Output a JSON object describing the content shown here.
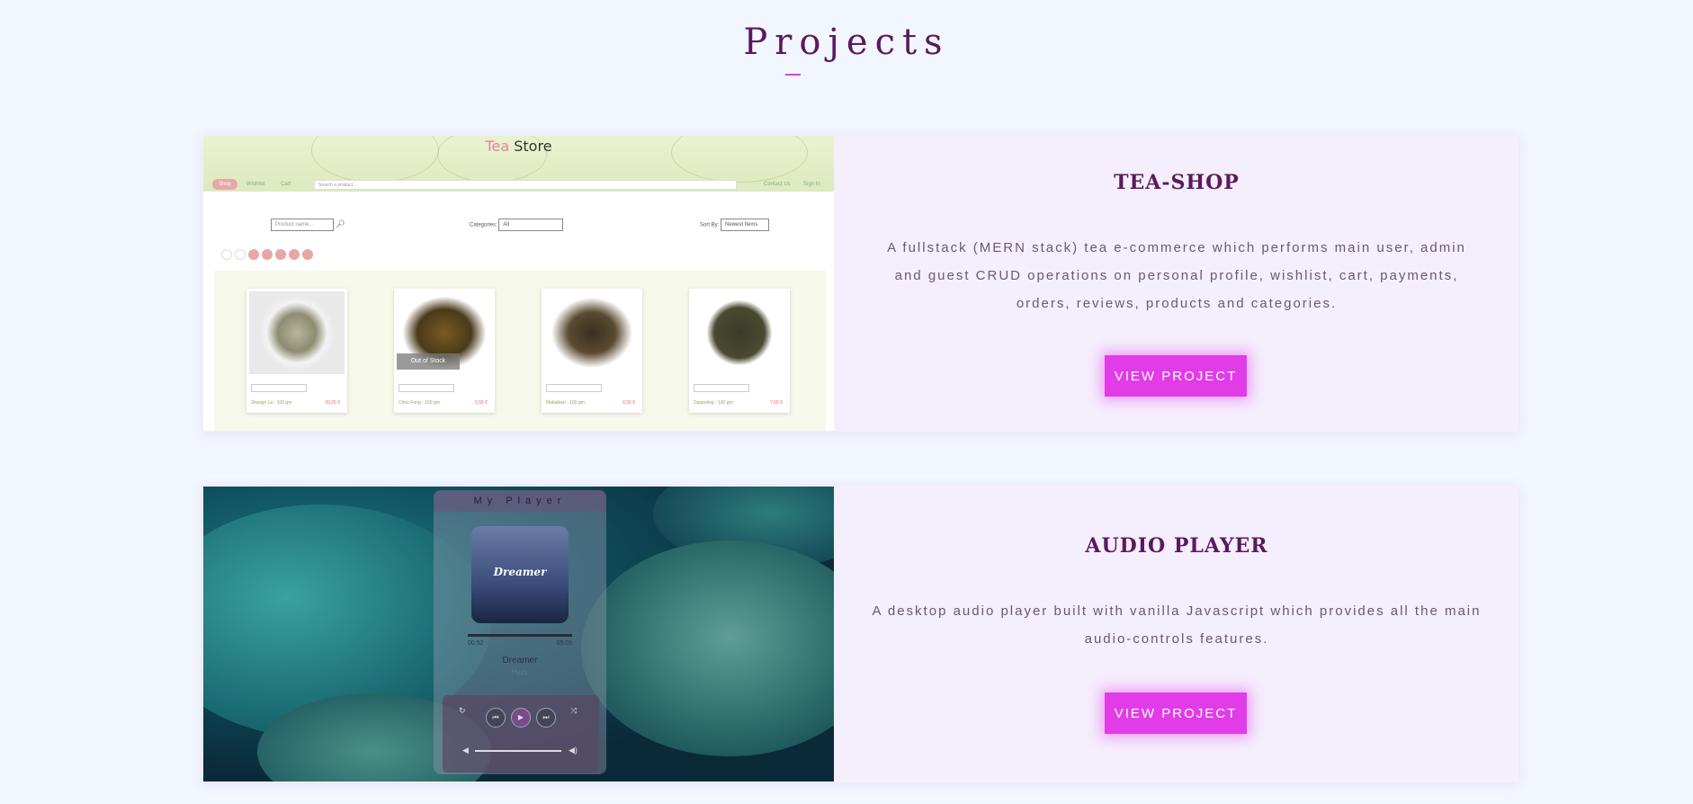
{
  "section": {
    "title": "Projects"
  },
  "projects": [
    {
      "title": "TEA-SHOP",
      "description": "A fullstack (MERN stack) tea e-commerce which performs main user, admin and guest CRUD operations on personal profile, wishlist, cart, payments, orders, reviews, products and categories.",
      "button_label": "VIEW PROJECT",
      "screenshot": {
        "logo_word1": "Tea",
        "logo_word2": "Store",
        "nav_items": [
          "Shop",
          "Wishlist",
          "Cart"
        ],
        "nav_right": [
          "Contact Us",
          "Sign In"
        ],
        "search_placeholder": "Search a product...",
        "product_search_placeholder": "Product name...",
        "categories_label": "Categories:",
        "categories_value": "All",
        "sort_label": "Sort By:",
        "sort_value": "Newest Items",
        "out_of_stock": "Out of Stock",
        "products": [
          {
            "name": "Shangri La - 100 gm",
            "price": "20,25 €"
          },
          {
            "name": "Chou Fong - 100 gm",
            "price": "5,55 €"
          },
          {
            "name": "Makaibari - 100 gm",
            "price": "6,55 €"
          },
          {
            "name": "Darjeeling - 100 gm",
            "price": "7,55 €"
          }
        ]
      }
    },
    {
      "title": "AUDIO PLAYER",
      "description": "A desktop audio player built with vanilla Javascript which provides all the main audio-controls features.",
      "button_label": "VIEW PROJECT",
      "screenshot": {
        "player_title": "My Player",
        "cover_word": "Dreamer",
        "time_current": "00:52",
        "time_total": "05:05",
        "song": "Dreamer",
        "artist": "Hazy"
      }
    }
  ],
  "colors": {
    "accent": "#e23ce8",
    "title": "#5a1a5e",
    "card_bg": "#f5eefc",
    "page_bg": "#f2f6ff"
  }
}
